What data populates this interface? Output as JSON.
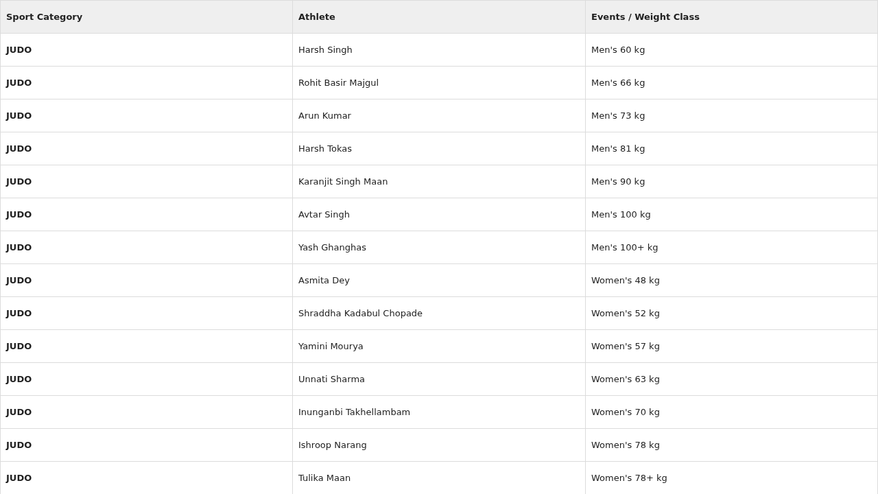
{
  "table": {
    "columns": [
      "Sport Category",
      "Athlete",
      "Events / Weight Class"
    ],
    "rows": [
      [
        "JUDO",
        "Harsh Singh",
        "Men's 60 kg"
      ],
      [
        "JUDO",
        "Rohit Basir Majgul",
        "Men's 66 kg"
      ],
      [
        "JUDO",
        "Arun Kumar",
        "Men's 73 kg"
      ],
      [
        "JUDO",
        "Harsh Tokas",
        "Men's 81 kg"
      ],
      [
        "JUDO",
        "Karanjit Singh Maan",
        "Men's 90 kg"
      ],
      [
        "JUDO",
        "Avtar Singh",
        "Men's 100 kg"
      ],
      [
        "JUDO",
        "Yash Ghanghas",
        "Men's 100+ kg"
      ],
      [
        "JUDO",
        "Asmita Dey",
        "Women's 48 kg"
      ],
      [
        "JUDO",
        "Shraddha Kadabul Chopade",
        "Women's 52 kg"
      ],
      [
        "JUDO",
        "Yamini Mourya",
        "Women's 57 kg"
      ],
      [
        "JUDO",
        "Unnati Sharma",
        "Women's 63 kg"
      ],
      [
        "JUDO",
        "Inunganbi Takhellambam",
        "Women's 70 kg"
      ],
      [
        "JUDO",
        "Ishroop Narang",
        "Women's 78 kg"
      ],
      [
        "JUDO",
        "Tulika Maan",
        "Women's 78+ kg"
      ]
    ]
  }
}
